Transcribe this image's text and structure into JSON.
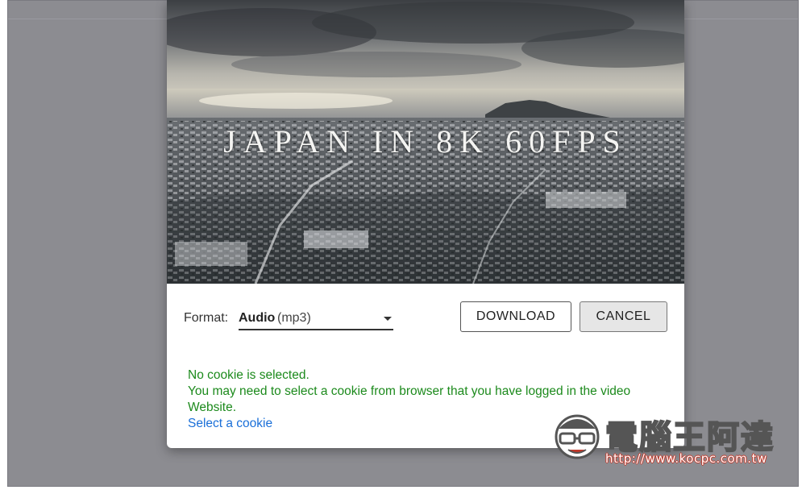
{
  "video": {
    "title_overlay": "JAPAN IN 8K 60FPS"
  },
  "format": {
    "label": "Format:",
    "selected_main": "Audio",
    "selected_sub": "(mp3)"
  },
  "buttons": {
    "download": "DOWNLOAD",
    "cancel": "CANCEL"
  },
  "message": {
    "line1": "No cookie is selected.",
    "line2": "You may need to select a cookie from browser that you have logged in the video Website.",
    "link": "Select a cookie"
  },
  "watermark": {
    "brand": "電腦王阿達",
    "url": "http://www.kocpc.com.tw"
  },
  "colors": {
    "message_green": "#1c8a1c",
    "link_blue": "#1a6fd8",
    "backdrop": "#8c8c91"
  }
}
